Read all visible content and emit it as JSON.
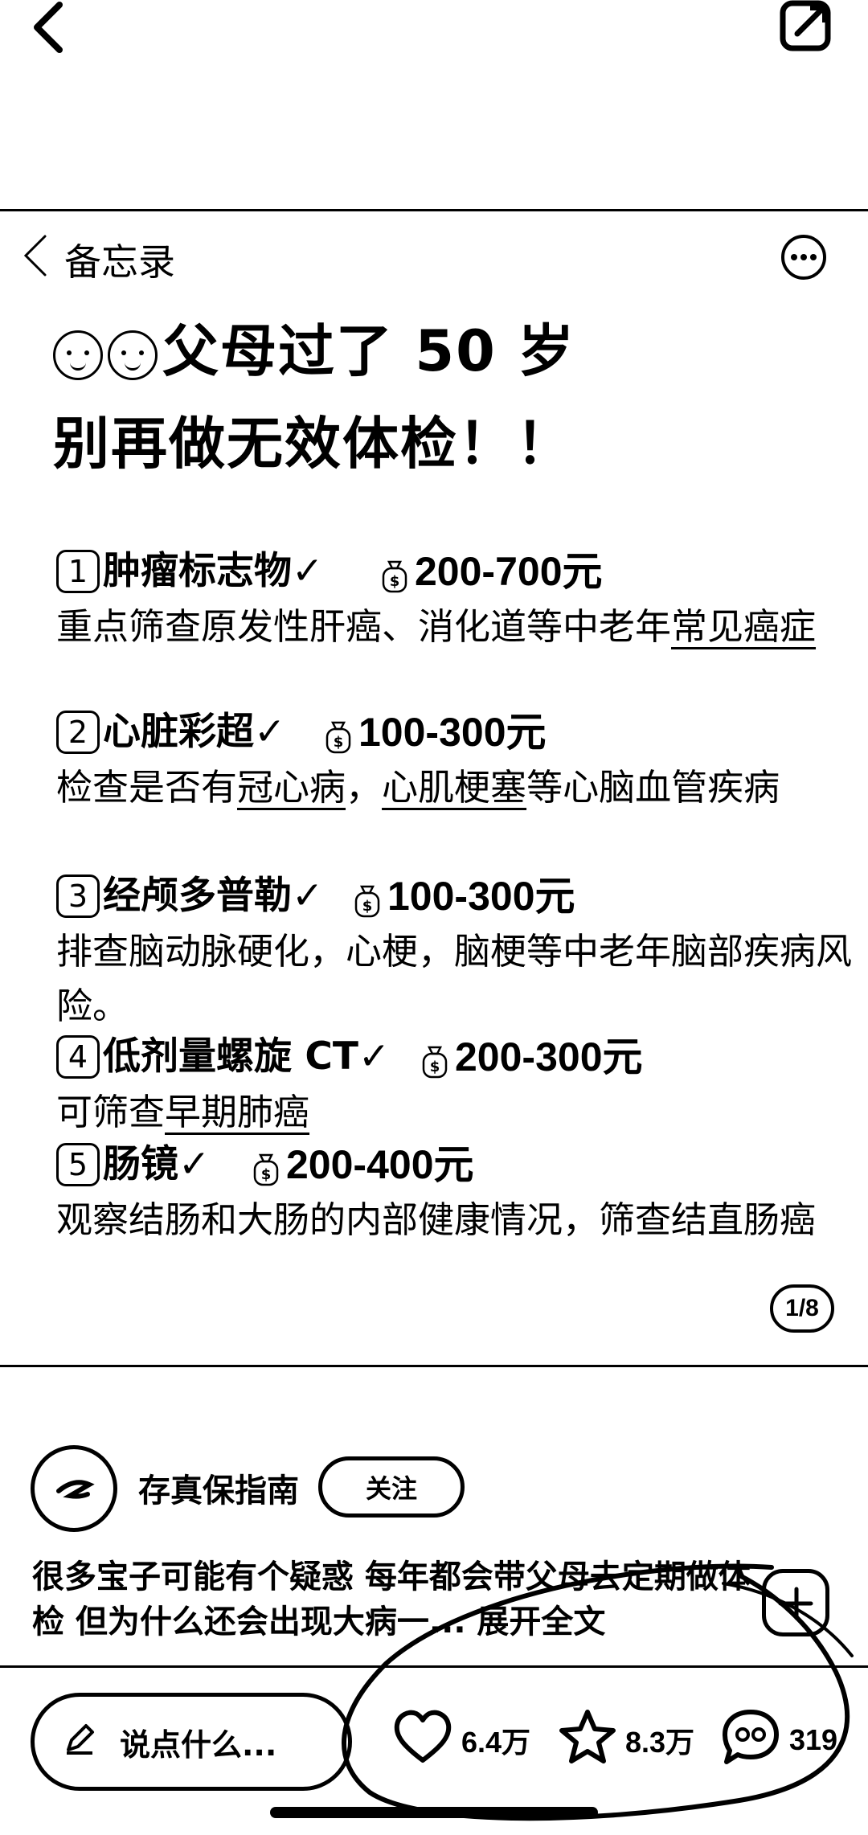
{
  "header": {
    "back_label": "备忘录"
  },
  "note": {
    "title_line1": "父母过了 50 岁",
    "title_line2": "别再做无效体检！！",
    "items": [
      {
        "num": "1",
        "name": "肿瘤标志物✓",
        "price": "200-700元",
        "desc_pre": "重点筛查原发性肝癌、消化道等中老年",
        "desc_ul1": "常见",
        "desc_mid": "",
        "desc_ul2": "癌症",
        "desc_post": ""
      },
      {
        "num": "2",
        "name": "心脏彩超✓",
        "price": "100-300元",
        "desc_pre": "检查是否有",
        "desc_ul1": "冠心病",
        "desc_mid": "，",
        "desc_ul2": "心肌梗塞",
        "desc_post": "等心脑血管疾病"
      },
      {
        "num": "3",
        "name": "经颅多普勒✓",
        "price": "100-300元",
        "desc_pre": "排查脑动脉硬化，心梗，脑梗等中老年脑部疾病风险。",
        "desc_ul1": "",
        "desc_mid": "",
        "desc_ul2": "",
        "desc_post": ""
      },
      {
        "num": "4",
        "name": "低剂量螺旋 CT✓",
        "price": "200-300元",
        "desc_pre": "可筛查",
        "desc_ul1": "早期肺癌",
        "desc_mid": "",
        "desc_ul2": "",
        "desc_post": ""
      },
      {
        "num": "5",
        "name": "肠镜✓",
        "price": "200-400元",
        "desc_pre": "观察结肠和大肠的内部健康情况，筛查结直肠癌",
        "desc_ul1": "",
        "desc_mid": "",
        "desc_ul2": "",
        "desc_post": ""
      }
    ],
    "page_indicator": "1/8"
  },
  "post": {
    "author": "存真保指南",
    "follow_label": "关注",
    "caption": "很多宝子可能有个疑惑 每年都会带父母去定期做体检 但为什么还会出现大病一... 展开全文"
  },
  "bottom_bar": {
    "comment_placeholder": "说点什么...",
    "likes": "6.4万",
    "favorites": "8.3万",
    "comments": "319"
  },
  "icons": [
    "back-arrow-icon",
    "share-edit-icon",
    "more-icon",
    "money-bag-icon",
    "pencil-icon",
    "heart-icon",
    "star-icon",
    "comment-icon"
  ]
}
